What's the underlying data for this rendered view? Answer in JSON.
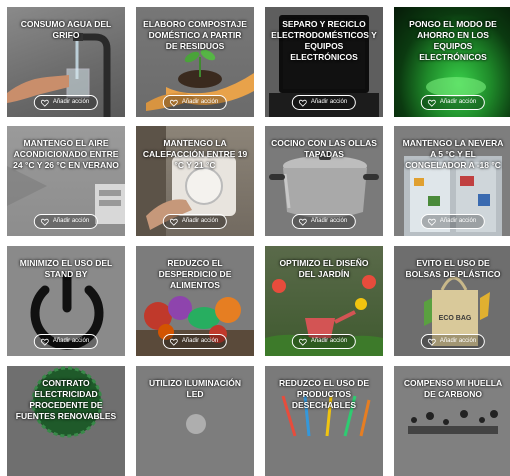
{
  "action_label": "Añadir acción",
  "cards": [
    {
      "title": "CONSUMO AGUA DEL GRIFO",
      "icon": "faucet-icon"
    },
    {
      "title": "ELABORO COMPOSTAJE DOMÉSTICO A PARTIR DE RESIDUOS",
      "icon": "sprout-hands-icon"
    },
    {
      "title": "SEPARO Y RECICLO ELECTRODOMÉSTICOS Y EQUIPOS ELECTRÓNICOS",
      "icon": "laptop-icon"
    },
    {
      "title": "PONGO EL MODO DE AHORRO EN LOS EQUIPOS ELECTRÓNICOS",
      "icon": "green-light-icon"
    },
    {
      "title": "MANTENGO EL AIRE ACONDICIONADO ENTRE 24 °C Y 26 °C EN VERANO",
      "icon": "air-conditioner-icon"
    },
    {
      "title": "MANTENGO LA CALEFACCIÓN ENTRE 19 °C Y 21 °C",
      "icon": "thermostat-icon"
    },
    {
      "title": "COCINO CON LAS OLLAS TAPADAS",
      "icon": "pot-icon"
    },
    {
      "title": "MANTENGO LA NEVERA A 5 °C Y EL CONGELADOR A -18 °C",
      "icon": "fridge-icon"
    },
    {
      "title": "MINIMIZO EL USO DEL STAND BY",
      "icon": "power-icon"
    },
    {
      "title": "REDUZCO EL DESPERDICIO DE ALIMENTOS",
      "icon": "vegetables-icon"
    },
    {
      "title": "OPTIMIZO EL DISEÑO DEL JARDÍN",
      "icon": "garden-icon"
    },
    {
      "title": "EVITO EL USO DE BOLSAS DE PLÁSTICO",
      "icon": "eco-bag-icon",
      "bag_text": "ECO BAG"
    },
    {
      "title": "CONTRATO ELECTRICIDAD PROCEDENTE DE FUENTES RENOVABLES",
      "icon": "badge-icon"
    },
    {
      "title": "UTILIZO ILUMINACIÓN LED",
      "icon": "led-bulb-icon"
    },
    {
      "title": "REDUZCO EL USO DE PRODUCTOS DESECHABLES",
      "icon": "straws-icon"
    },
    {
      "title": "COMPENSO MI HUELLA DE CARBONO",
      "icon": "footprint-icon"
    }
  ]
}
